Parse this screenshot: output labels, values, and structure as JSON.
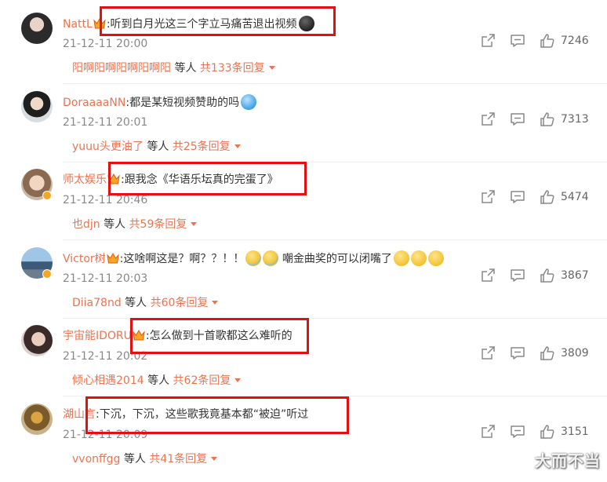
{
  "comments": [
    {
      "username": "NattL",
      "text": ":听到白月光这三个字立马痛苦退出视频",
      "timestamp": "21-12-11 20:00",
      "likes": "7246",
      "reply_user": "阳啊阳啊阳啊阳啊阳",
      "reply_mid": " 等人 ",
      "reply_count": "共133条回复"
    },
    {
      "username": "DoraaaaNN",
      "text": ":都是某短视频赞助的吗",
      "timestamp": "21-12-11 20:01",
      "likes": "7313",
      "reply_user": "yuuu头更油了",
      "reply_mid": " 等人 ",
      "reply_count": "共25条回复"
    },
    {
      "username": "师太娱乐",
      "text": ":跟我念《华语乐坛真的完蛋了》",
      "timestamp": "21-12-11 20:46",
      "likes": "5474",
      "reply_user": "也djn",
      "reply_mid": " 等人 ",
      "reply_count": "共59条回复"
    },
    {
      "username": "Victor树",
      "text": ":这啥啊这是？啊？？！！",
      "text2": "嘲金曲奖的可以闭嘴了",
      "timestamp": "21-12-11 20:03",
      "likes": "3867",
      "reply_user": "Diia78nd",
      "reply_mid": " 等人 ",
      "reply_count": "共60条回复"
    },
    {
      "username": "宇宙能IDORU",
      "text": ":怎么做到十首歌都这么难听的",
      "timestamp": "21-12-11 20:02",
      "likes": "3809",
      "reply_user": "倾心相遇2014",
      "reply_mid": " 等人 ",
      "reply_count": "共62条回复"
    },
    {
      "username": "湖山言",
      "text": ":下沉，下沉，这些歌我竟基本都“被迫”听过",
      "timestamp": "21-12-11 20:09",
      "likes": "3151",
      "reply_user": "vvonffgg",
      "reply_mid": " 等人 ",
      "reply_count": "共41条回复"
    }
  ],
  "watermark": "大而不当",
  "colors": {
    "username": "#eb7350",
    "highlight_box": "#e50f0f",
    "timestamp": "#888888"
  },
  "icons": [
    "share-icon",
    "comment-icon",
    "like-icon",
    "crown-badge-icon",
    "verified-badge-icon",
    "emoji-icon",
    "caret-down-icon"
  ]
}
